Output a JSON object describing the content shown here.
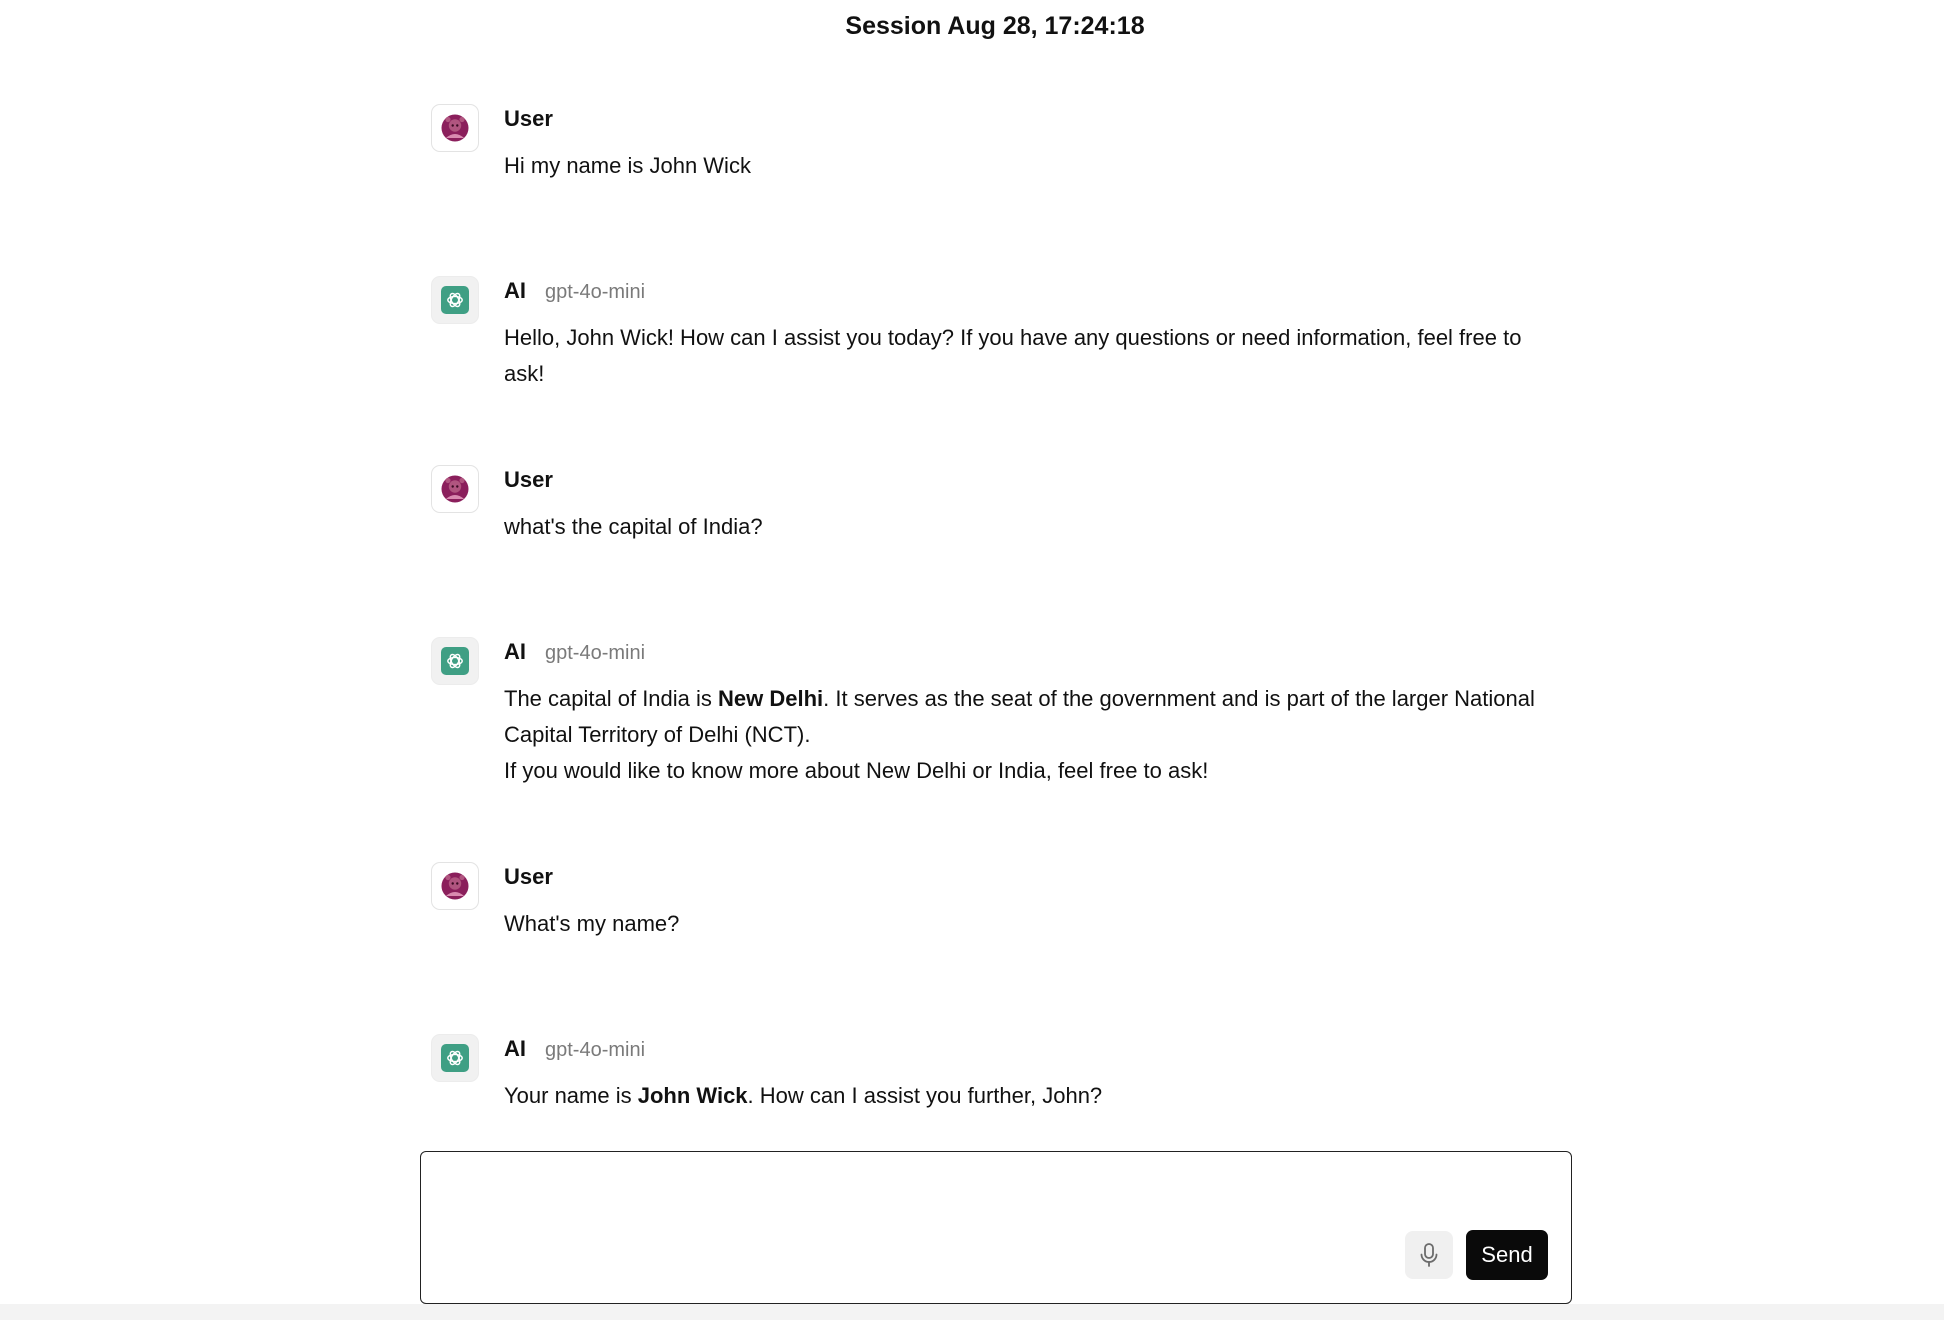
{
  "session": {
    "title": "Session Aug 28, 17:24:18"
  },
  "messages": [
    {
      "role": "user",
      "author": "User",
      "model": "",
      "paragraphs": [
        [
          {
            "text": "Hi my name is John Wick",
            "bold": false
          }
        ]
      ]
    },
    {
      "role": "ai",
      "author": "AI",
      "model": "gpt-4o-mini",
      "paragraphs": [
        [
          {
            "text": "Hello, John Wick! How can I assist you today? If you have any questions or need information, feel free to ask!",
            "bold": false
          }
        ]
      ]
    },
    {
      "role": "user",
      "author": "User",
      "model": "",
      "paragraphs": [
        [
          {
            "text": "what's the capital of India?",
            "bold": false
          }
        ]
      ]
    },
    {
      "role": "ai",
      "author": "AI",
      "model": "gpt-4o-mini",
      "paragraphs": [
        [
          {
            "text": "The capital of India is ",
            "bold": false
          },
          {
            "text": "New Delhi",
            "bold": true
          },
          {
            "text": ". It serves as the seat of the government and is part of the larger National Capital Territory of Delhi (NCT).",
            "bold": false
          }
        ],
        [
          {
            "text": "If you would like to know more about New Delhi or India, feel free to ask!",
            "bold": false
          }
        ]
      ]
    },
    {
      "role": "user",
      "author": "User",
      "model": "",
      "paragraphs": [
        [
          {
            "text": "What's my name?",
            "bold": false
          }
        ]
      ]
    },
    {
      "role": "ai",
      "author": "AI",
      "model": "gpt-4o-mini",
      "paragraphs": [
        [
          {
            "text": "Your name is ",
            "bold": false
          },
          {
            "text": "John Wick",
            "bold": true
          },
          {
            "text": ". How can I assist you further, John?",
            "bold": false
          }
        ]
      ]
    }
  ],
  "composer": {
    "value": "",
    "placeholder": "",
    "send_label": "Send",
    "mic_icon": "microphone-icon"
  },
  "icons": {
    "user_avatar": "user-avatar-icon",
    "ai_avatar": "openai-logo-icon"
  },
  "colors": {
    "user_avatar": "#8b1f5c",
    "ai_avatar": "#3f9f84",
    "send_button": "#0a0a0a",
    "model_label": "#7a7a7a"
  }
}
